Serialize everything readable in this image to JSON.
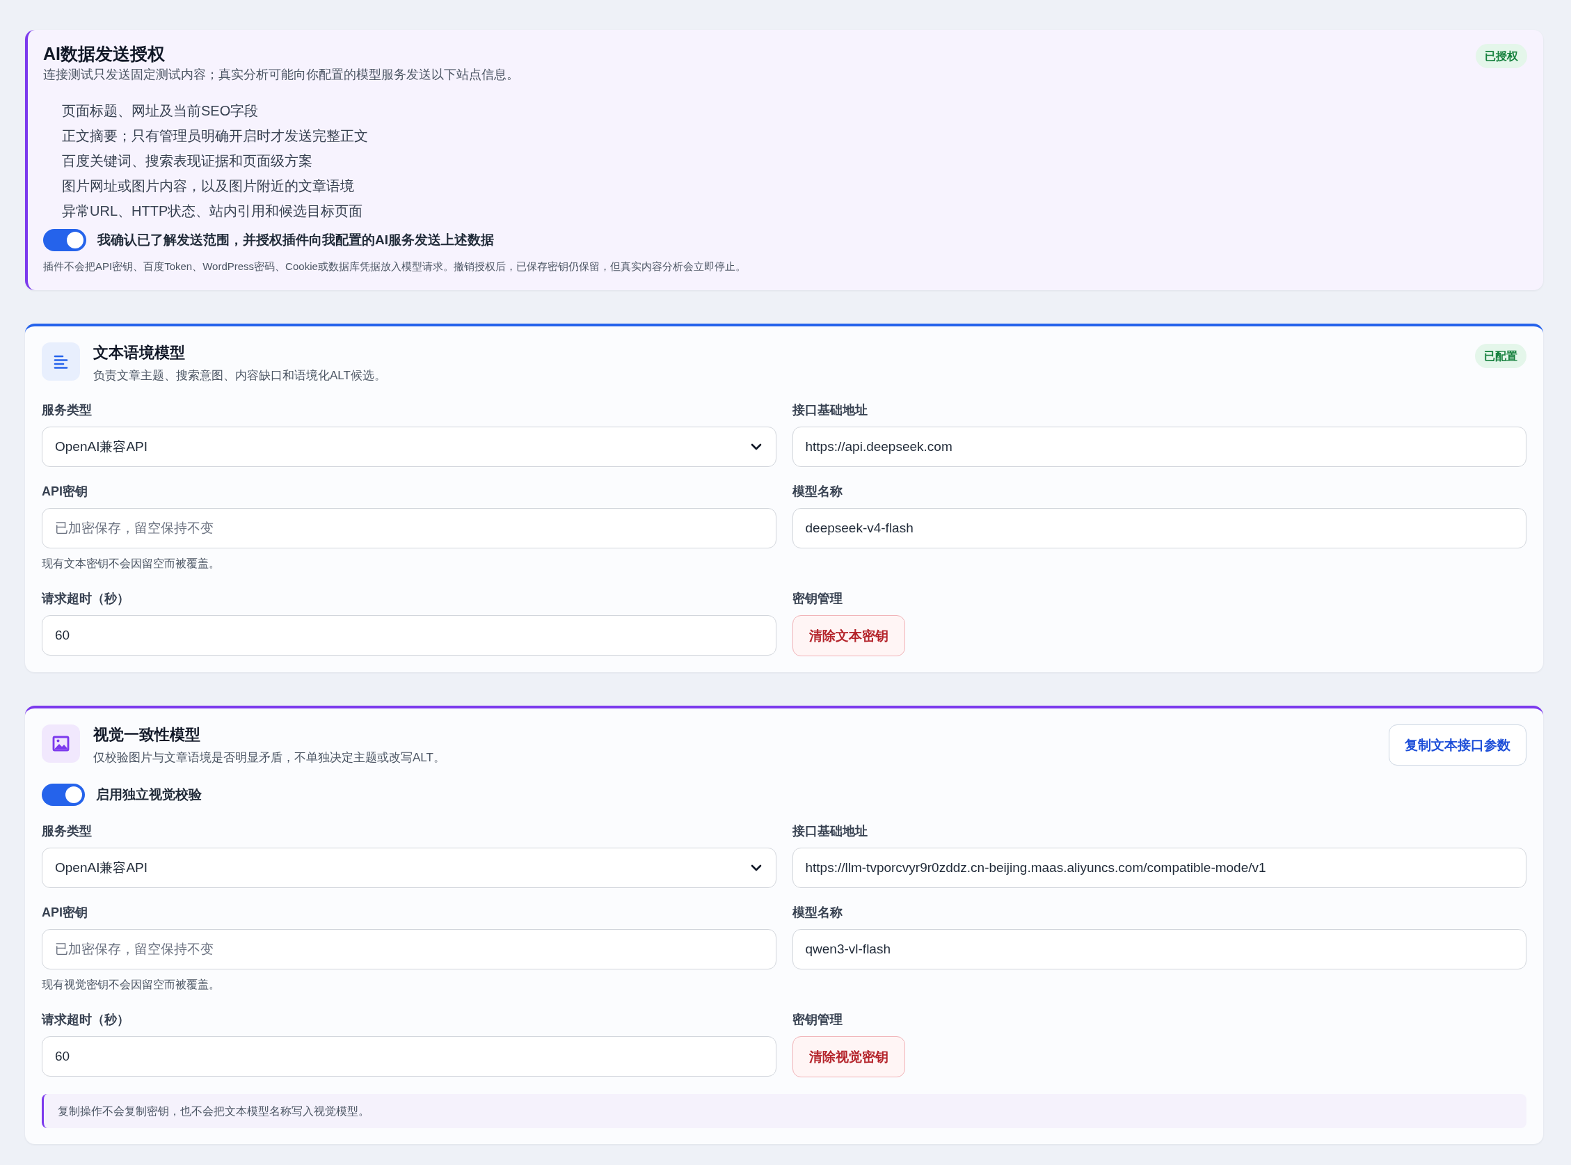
{
  "authorization": {
    "title": "AI数据发送授权",
    "description": "连接测试只发送固定测试内容；真实分析可能向你配置的模型服务发送以下站点信息。",
    "status_badge": "已授权",
    "items": [
      "页面标题、网址及当前SEO字段",
      "正文摘要；只有管理员明确开启时才发送完整正文",
      "百度关键词、搜索表现证据和页面级方案",
      "图片网址或图片内容，以及图片附近的文章语境",
      "异常URL、HTTP状态、站内引用和候选目标页面"
    ],
    "consent_toggle": {
      "label": "我确认已了解发送范围，并授权插件向我配置的AI服务发送上述数据",
      "on": true
    },
    "footnote": "插件不会把API密钥、百度Token、WordPress密码、Cookie或数据库凭据放入模型请求。撤销授权后，已保存密钥仍保留，但真实内容分析会立即停止。"
  },
  "model_cards": [
    {
      "kind": "text",
      "title": "文本语境模型",
      "description": "负责文章主题、搜索意图、内容缺口和语境化ALT候选。",
      "status_badge": "已配置",
      "fields": [
        {
          "kind": "select",
          "label": "服务类型",
          "value": "OpenAI兼容API"
        },
        {
          "kind": "input",
          "label": "接口基础地址",
          "value": "https://api.deepseek.com"
        },
        {
          "kind": "input",
          "label": "API密钥",
          "placeholder": "已加密保存，留空保持不变",
          "hint": "现有文本密钥不会因留空而被覆盖。"
        },
        {
          "kind": "input",
          "label": "模型名称",
          "value": "deepseek-v4-flash"
        },
        {
          "kind": "input",
          "label": "请求超时（秒）",
          "value": "60"
        },
        {
          "kind": "action",
          "label": "密钥管理",
          "button": "清除文本密钥"
        }
      ]
    },
    {
      "kind": "vision",
      "title": "视觉一致性模型",
      "description": "仅校验图片与文章语境是否明显矛盾，不单独决定主题或改写ALT。",
      "header_button": "复制文本接口参数",
      "toggle": {
        "label": "启用独立视觉校验",
        "on": true
      },
      "fields": [
        {
          "kind": "select",
          "label": "服务类型",
          "value": "OpenAI兼容API"
        },
        {
          "kind": "input",
          "label": "接口基础地址",
          "value": "https://llm-tvporcvyr9r0zddz.cn-beijing.maas.aliyuncs.com/compatible-mode/v1"
        },
        {
          "kind": "input",
          "label": "API密钥",
          "placeholder": "已加密保存，留空保持不变",
          "hint": "现有视觉密钥不会因留空而被覆盖。"
        },
        {
          "kind": "input",
          "label": "模型名称",
          "value": "qwen3-vl-flash"
        },
        {
          "kind": "input",
          "label": "请求超时（秒）",
          "value": "60"
        },
        {
          "kind": "action",
          "label": "密钥管理",
          "button": "清除视觉密钥"
        }
      ],
      "note": "复制操作不会复制密钥，也不会把文本模型名称写入视觉模型。"
    }
  ]
}
